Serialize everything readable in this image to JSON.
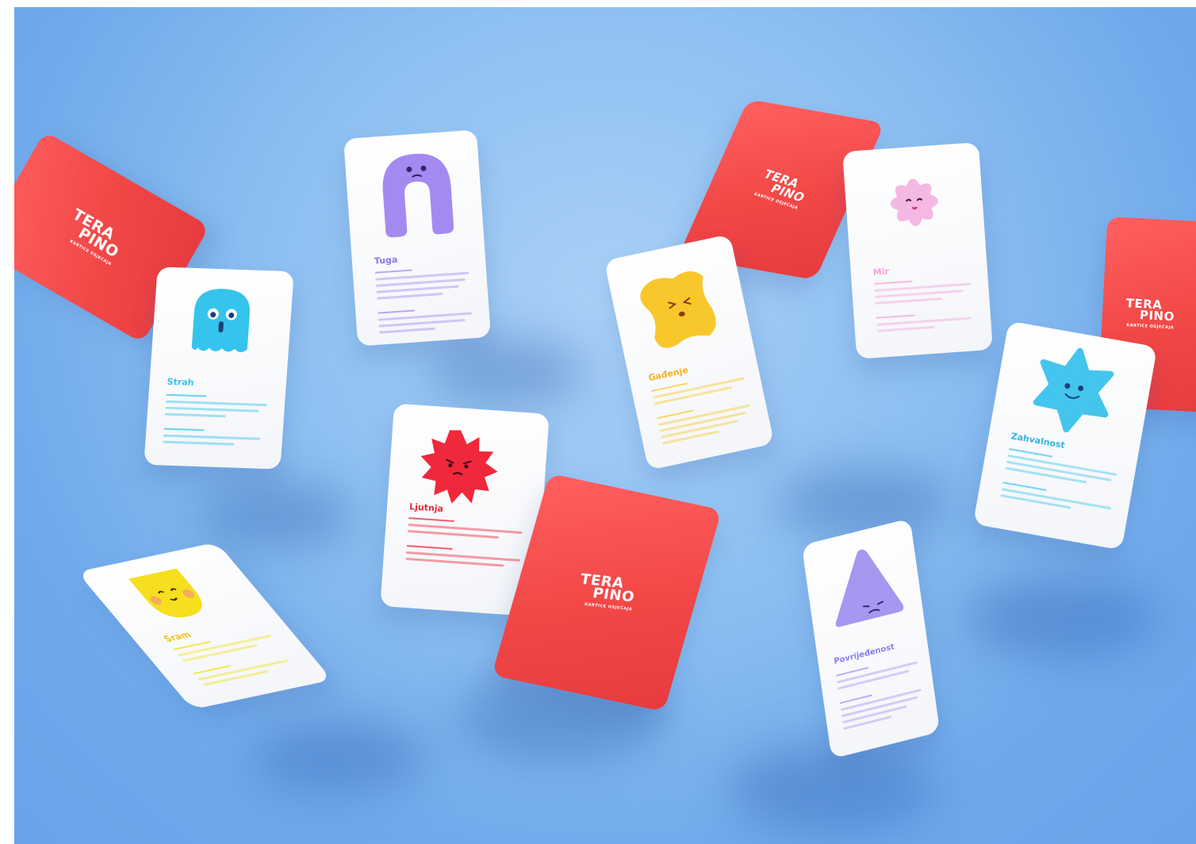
{
  "scene": {
    "background_color": "#8dbff1",
    "card_back_color": "#f24747",
    "card_front_color": "#f6f7fa"
  },
  "card_back": {
    "logo_line1": "TERA",
    "logo_line2": "PINO",
    "logo_tagline": "KARTICE OSJEĆAJA"
  },
  "cards": {
    "strah": {
      "title": "Strah",
      "color": "#35c4ec",
      "icon": "ghost-icon"
    },
    "tuga": {
      "title": "Tuga",
      "color": "#a48af0",
      "icon": "arch-icon"
    },
    "gadjenje": {
      "title": "Gađenje",
      "color": "#f8c72b",
      "icon": "blob-icon"
    },
    "ljutnja": {
      "title": "Ljutnja",
      "color": "#f0283b",
      "icon": "spiky-sun-icon"
    },
    "sram": {
      "title": "Sram",
      "color": "#f5df1e",
      "icon": "shield-icon"
    },
    "mir": {
      "title": "Mir",
      "color": "#f5a3d9",
      "icon": "flower-icon"
    },
    "zahvalnost": {
      "title": "Zahvalnost",
      "color": "#43c5ee",
      "icon": "star-icon"
    },
    "povrijedjenost": {
      "title": "Povrijeđenost",
      "color": "#a697f0",
      "icon": "triangle-icon"
    }
  }
}
